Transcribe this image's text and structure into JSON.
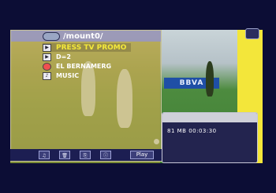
{
  "browser": {
    "path": "/mount0/",
    "items": [
      {
        "label": "PRESS TV PROMO",
        "icon": "video-file-icon",
        "selected": true
      },
      {
        "label": "D=2",
        "icon": "video-file-icon",
        "selected": false
      },
      {
        "label": "EL BERNAMERG",
        "icon": "eraser-icon",
        "selected": false
      },
      {
        "label": "MUSIC",
        "icon": "music-file-icon",
        "selected": false
      }
    ]
  },
  "toolbar": {
    "buttons": [
      "mp3-button",
      "trash-button",
      "copy-button",
      "info-button"
    ],
    "play_label": "Play"
  },
  "info": {
    "size_time": "81 MB  00:03:30"
  },
  "background": {
    "banner": "BBVA"
  }
}
